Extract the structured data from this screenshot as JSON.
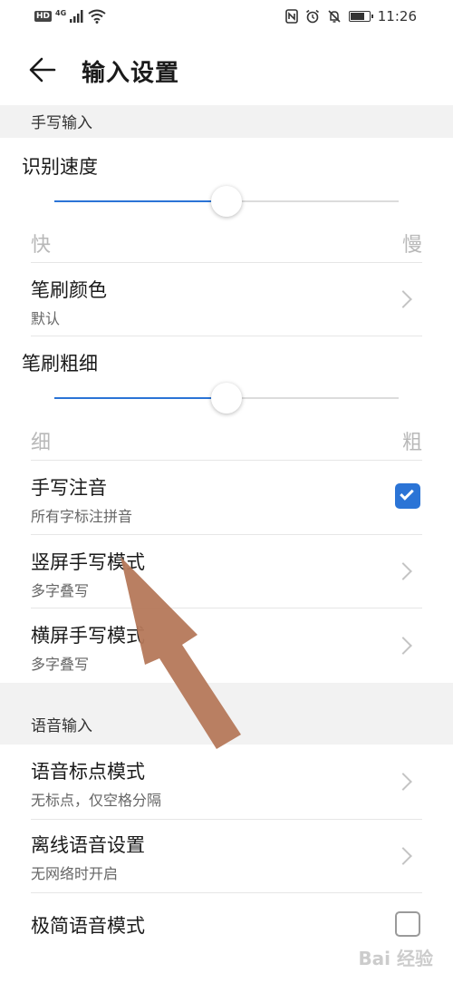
{
  "status_bar": {
    "left_badge": "HD",
    "network": "4G",
    "time": "11:26",
    "battery_level": 0.8,
    "icons": [
      "hd-icon",
      "signal-icon",
      "wifi-icon",
      "nfc-icon",
      "alarm-icon",
      "mute-icon",
      "battery-icon"
    ]
  },
  "header": {
    "title": "输入设置",
    "back_icon": "back-arrow-icon"
  },
  "handwriting": {
    "section_title": "手写输入",
    "speed": {
      "title": "识别速度",
      "left_label": "快",
      "right_label": "慢",
      "value": 0.5
    },
    "brush_color": {
      "title": "笔刷颜色",
      "subtitle": "默认"
    },
    "brush_width": {
      "title": "笔刷粗细",
      "left_label": "细",
      "right_label": "粗",
      "value": 0.5
    },
    "pinyin": {
      "title": "手写注音",
      "subtitle": "所有字标注拼音",
      "checked": true
    },
    "portrait_mode": {
      "title": "竖屏手写模式",
      "subtitle": "多字叠写"
    },
    "landscape_mode": {
      "title": "横屏手写模式",
      "subtitle": "多字叠写"
    }
  },
  "voice": {
    "section_title": "语音输入",
    "punctuation_mode": {
      "title": "语音标点模式",
      "subtitle": "无标点，仅空格分隔"
    },
    "offline": {
      "title": "离线语音设置",
      "subtitle": "无网络时开启"
    },
    "simple_mode": {
      "title": "极简语音模式",
      "checked": false
    }
  },
  "watermark": "Bai 经验",
  "colors": {
    "accent": "#2b74d6",
    "annotation_arrow": "#b5785a",
    "section_bg": "#f2f2f2"
  }
}
